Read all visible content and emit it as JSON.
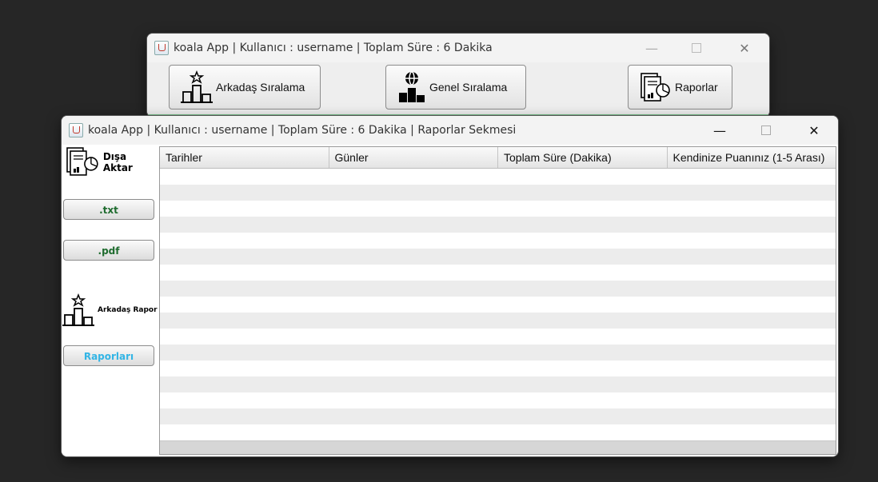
{
  "main_window": {
    "title": "koala App | Kullanıcı : username | Toplam Süre : 6 Dakika",
    "buttons": {
      "friend_ranking": "Arkadaş Sıralama",
      "general_ranking": "Genel Sıralama",
      "reports": "Raporlar"
    }
  },
  "report_window": {
    "title": "koala App | Kullanıcı : username | Toplam Süre : 6 Dakika | Raporlar Sekmesi",
    "sidebar": {
      "export_label": "Dışa Aktar",
      "txt_button": ".txt",
      "pdf_button": ".pdf",
      "friend_report_label": "Arkadaş Rapor",
      "reports_button": "Raporları"
    },
    "table": {
      "columns": [
        "Tarihler",
        "Günler",
        "Toplam Süre (Dakika)",
        "Kendinize Puanınız (1-5 Arası)"
      ],
      "rows": []
    }
  },
  "colors": {
    "txt_button_text": "#1e6b2e",
    "pdf_button_text": "#1e6b2e",
    "reports_button_text": "#33b5e5",
    "accent_line": "#7ac38b"
  },
  "window_controls": {
    "minimize": "—",
    "close": "✕"
  }
}
